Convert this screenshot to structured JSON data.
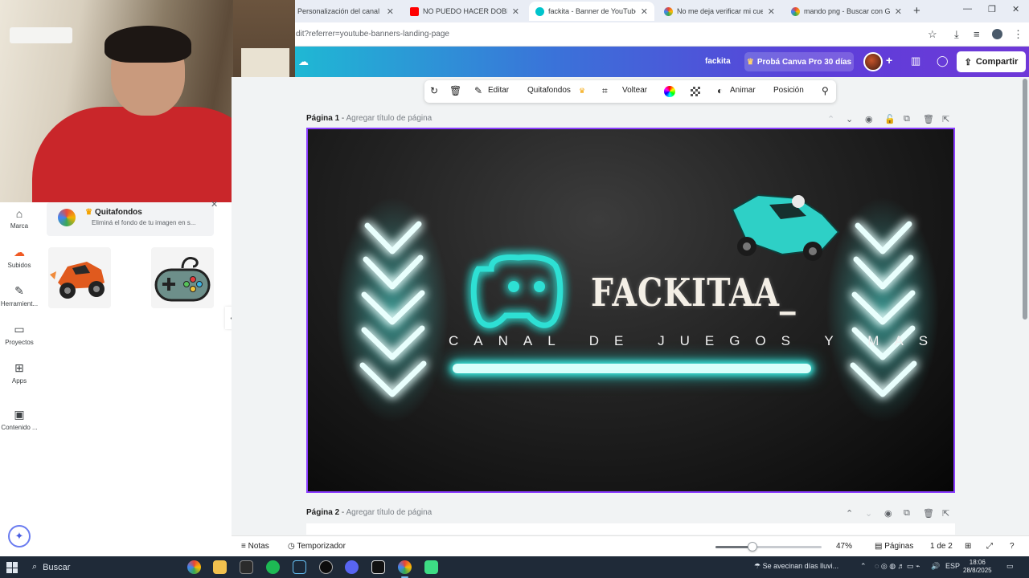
{
  "browser": {
    "tabs": [
      {
        "title": "Personalización del canal - You",
        "color": "#ff0000"
      },
      {
        "title": "NO PUEDO HACER DOBLE SAL",
        "color": "#ff0000"
      },
      {
        "title": "fackita - Banner de YouTube",
        "color": "#00c4cc"
      },
      {
        "title": "No me deja verificar mi cuenta",
        "color": "#4285f4"
      },
      {
        "title": "mando png - Buscar con Goog",
        "color": "#4285f4"
      }
    ],
    "url": "dit?referrer=youtube-banners-landing-page"
  },
  "canva_header": {
    "doc_name": "fackita",
    "pro_button": "Probá Canva Pro 30 días",
    "share_button": "Compartir"
  },
  "context_toolbar": {
    "edit": "Editar",
    "bg_remover": "Quitafondos",
    "flip": "Voltear",
    "animate": "Animar",
    "position": "Posición"
  },
  "sidebar": {
    "items": [
      {
        "label": "Marca",
        "icon": "brand-icon"
      },
      {
        "label": "Subidos",
        "icon": "upload-icon"
      },
      {
        "label": "Herramient...",
        "icon": "tools-icon"
      },
      {
        "label": "Proyectos",
        "icon": "folder-icon"
      },
      {
        "label": "Apps",
        "icon": "apps-icon"
      },
      {
        "label": "Contenido ...",
        "icon": "media-icon"
      }
    ]
  },
  "tip_card": {
    "title": "Quitafondos",
    "description": "Eliminá el fondo de tu imagen en s..."
  },
  "pages": {
    "page1_label": "Página 1",
    "page1_title_placeholder": "Agregar título de página",
    "page2_label": "Página 2",
    "page2_title_placeholder": "Agregar título de página"
  },
  "banner": {
    "title": "FACKITAA_",
    "subtitle": "CANAL DE JUEGOS Y MAS",
    "accent_color": "#2fe0d4"
  },
  "statusbar": {
    "notes": "Notas",
    "timer": "Temporizador",
    "zoom": "47%",
    "zoom_level": 0.47,
    "pages_button": "Páginas",
    "page_count": "1 de 2"
  },
  "taskbar": {
    "search_placeholder": "Buscar",
    "weather": "Se avecinan días lluvi...",
    "language": "ESP",
    "time": "18:06",
    "date": "28/8/2025"
  }
}
